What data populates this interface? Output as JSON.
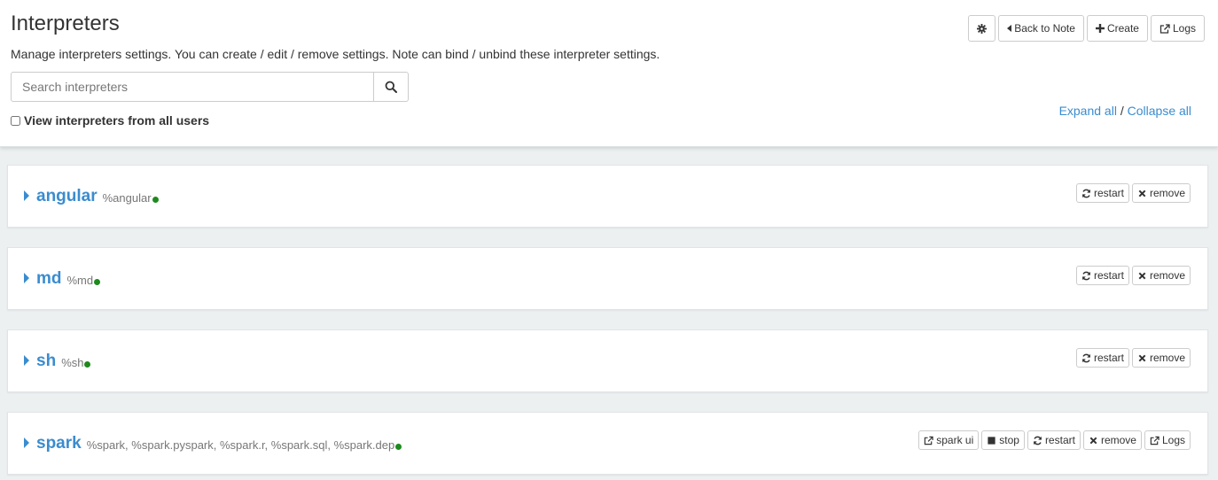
{
  "header": {
    "title": "Interpreters",
    "description": "Manage interpreters settings. You can create / edit / remove settings. Note can bind / unbind these interpreter settings.",
    "search_placeholder": "Search interpreters",
    "view_all_label": "View interpreters from all users",
    "expand_all": "Expand all",
    "separator": "/",
    "collapse_all": "Collapse all",
    "actions": {
      "back_label": "Back to Note",
      "create_label": "Create",
      "logs_label": "Logs"
    }
  },
  "colors": {
    "accent": "#3a8ccf",
    "status_running": "#1e8a1e",
    "background": "#ecf0f1"
  },
  "interpreters": [
    {
      "name": "angular",
      "bindings": "%angular",
      "status": "running",
      "actions": {
        "restart": "restart",
        "remove": "remove"
      }
    },
    {
      "name": "md",
      "bindings": "%md",
      "status": "running",
      "actions": {
        "restart": "restart",
        "remove": "remove"
      }
    },
    {
      "name": "sh",
      "bindings": "%sh",
      "status": "running",
      "actions": {
        "restart": "restart",
        "remove": "remove"
      }
    },
    {
      "name": "spark",
      "bindings": "%spark, %spark.pyspark, %spark.r, %spark.sql, %spark.dep",
      "status": "running",
      "actions": {
        "spark_ui": "spark ui",
        "stop": "stop",
        "restart": "restart",
        "remove": "remove",
        "logs": "Logs"
      }
    }
  ]
}
